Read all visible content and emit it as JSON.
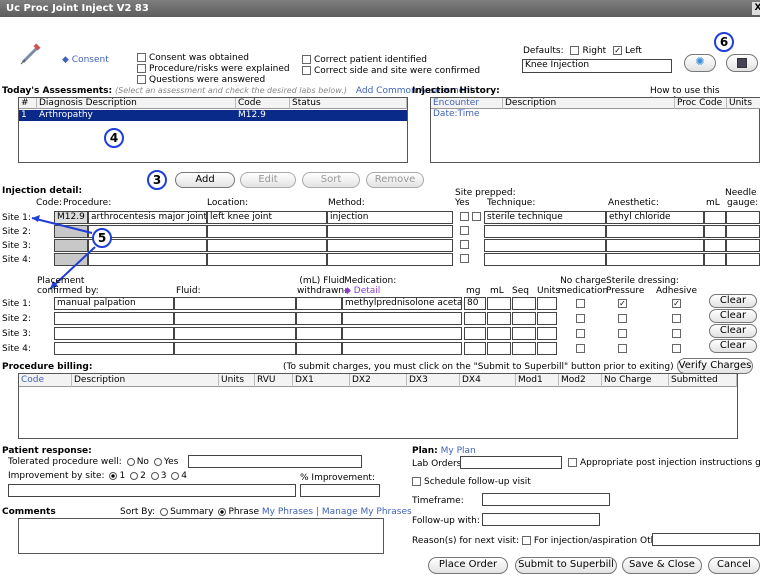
{
  "window": {
    "title": "Uc Proc Joint Inject V2 83",
    "close": "X"
  },
  "top": {
    "consent_link": "Consent",
    "consent_cb": [
      "Consent was obtained",
      "Procedure/risks were explained",
      "Questions were answered"
    ],
    "verify_cb": [
      "Correct patient identified",
      "Correct side and site were confirmed"
    ],
    "defaults_label": "Defaults:",
    "right_label": "Right",
    "left_label": "Left",
    "right_checked": false,
    "left_checked": true,
    "template_value": "Knee Injection"
  },
  "callouts": {
    "c3": "3",
    "c4": "4",
    "c5": "5",
    "c6": "6"
  },
  "assessments": {
    "title": "Today's Assessments:",
    "hint": "(Select an assessment and check the desired labs below.)",
    "add_common": "Add Common Assessment",
    "cols": [
      "#",
      "Diagnosis Description",
      "Code",
      "Status"
    ],
    "rows": [
      {
        "num": "1",
        "desc": "Arthropathy",
        "code": "M12.9",
        "status": ""
      }
    ]
  },
  "history": {
    "title": "Injection History:",
    "howto": "How to use this template:",
    "cols": [
      "Encounter Date:Time",
      "Description",
      "Proc Code",
      "Units"
    ]
  },
  "assess_buttons": {
    "add": "Add",
    "edit": "Edit",
    "sort": "Sort",
    "remove": "Remove"
  },
  "injection": {
    "title": "Injection detail:",
    "site_prepped": "Site prepped:",
    "col_code": "Code:",
    "col_procedure": "Procedure:",
    "col_location": "Location:",
    "col_method": "Method:",
    "col_yes": "Yes",
    "col_technique": "Technique:",
    "col_anesthetic": "Anesthetic:",
    "col_ml": "mL",
    "col_needle": "Needle",
    "col_gauge": "gauge:",
    "sites": [
      {
        "label": "Site 1:",
        "code": "M12.9",
        "procedure": "arthrocentesis major joint",
        "location": "left knee joint",
        "method": "injection",
        "technique": "sterile technique",
        "anesthetic": "ethyl chloride"
      },
      {
        "label": "Site 2:"
      },
      {
        "label": "Site 3:"
      },
      {
        "label": "Site 4:"
      }
    ]
  },
  "placement": {
    "placement_l1": "Placement",
    "placement_l2": "confirmed by:",
    "fluid": "Fluid:",
    "ml_fluid_l1": "(mL) Fluid",
    "ml_fluid_l2": "withdrawn:",
    "medication": "Medication:",
    "detail": "Detail",
    "mg": "mg",
    "ml": "mL",
    "seq": "Seq",
    "units": "Units",
    "nocharge_l1": "No charge",
    "nocharge_l2": "medication",
    "sterile": "Sterile dressing:",
    "pressure": "Pressure",
    "adhesive": "Adhesive",
    "clear": "Clear",
    "sites": [
      {
        "label": "Site 1:",
        "confirmed": "manual palpation",
        "medication": "methylprednisolone acetate",
        "mg": "80",
        "pressure": true,
        "adhesive": true
      },
      {
        "label": "Site 2:"
      },
      {
        "label": "Site 3:"
      },
      {
        "label": "Site 4:"
      }
    ]
  },
  "billing": {
    "title": "Procedure billing:",
    "note": "(To submit charges, you must click on the \"Submit to Superbill\" button prior to exiting)",
    "verify": "Verify Charges",
    "cols": [
      "Code",
      "Description",
      "Units",
      "RVU",
      "DX1",
      "DX2",
      "DX3",
      "DX4",
      "Mod1",
      "Mod2",
      "No Charge",
      "Submitted"
    ]
  },
  "response": {
    "title": "Patient response:",
    "tolerated": "Tolerated procedure well:",
    "no": "No",
    "yes": "Yes",
    "improvement": "Improvement by site:",
    "opts": [
      "1",
      "2",
      "3",
      "4"
    ],
    "pct": "% Improvement:"
  },
  "comments": {
    "title": "Comments",
    "sortby": "Sort By:",
    "summary": "Summary",
    "phrase": "Phrase",
    "myphrases": "My Phrases | Manage My Phrases"
  },
  "plan": {
    "title": "Plan:",
    "myplan": "My Plan",
    "lab": "Lab Orders:",
    "approp": "Appropriate post injection instructions given",
    "followup": "Schedule follow-up visit",
    "timeframe": "Timeframe:",
    "followwith": "Follow-up with:",
    "reasons": "Reason(s) for next visit:",
    "forinj": "For injection/aspiration",
    "other": "Other:"
  },
  "footer": {
    "place": "Place Order",
    "submit": "Submit to Superbill",
    "save": "Save & Close",
    "cancel": "Cancel"
  }
}
